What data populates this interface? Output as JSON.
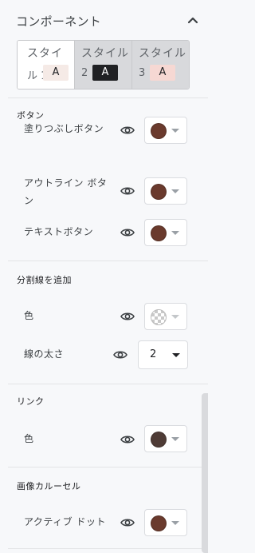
{
  "header": {
    "title": "コンポーネント"
  },
  "styles": [
    {
      "name": "スタイ",
      "name2": "ル",
      "num": "1",
      "chip": "A",
      "chip_bg": "#f5eae6",
      "chip_fg": "#202124",
      "active": true
    },
    {
      "name": "スタイル",
      "num": "2",
      "chip": "A",
      "chip_bg": "#202124",
      "chip_fg": "#ffffff",
      "active": false
    },
    {
      "name": "スタイル",
      "num": "3",
      "chip": "A",
      "chip_bg": "#f6d8d3",
      "chip_fg": "#202124",
      "active": false
    }
  ],
  "sections": {
    "buttons": "ボタン",
    "divider": "分割線を追加",
    "link": "リンク",
    "carousel": "画像カルーセル"
  },
  "rows": {
    "filled": "塗りつぶしボタン",
    "outline_1": "アウトライン ボタ",
    "outline_2": "ン",
    "text_btn": "テキストボタン",
    "div_color": "色",
    "div_width": "線の太さ",
    "div_width_value": "2",
    "link_color": "色",
    "active_dot": "アクティブ ドット"
  },
  "colors": {
    "filled": "#6a3a2d",
    "outline": "#6a3a2d",
    "text_btn": "#6a3a2d",
    "link": "#4f3c36",
    "active_dot": "#6a3a2d",
    "divider": "transparent"
  }
}
